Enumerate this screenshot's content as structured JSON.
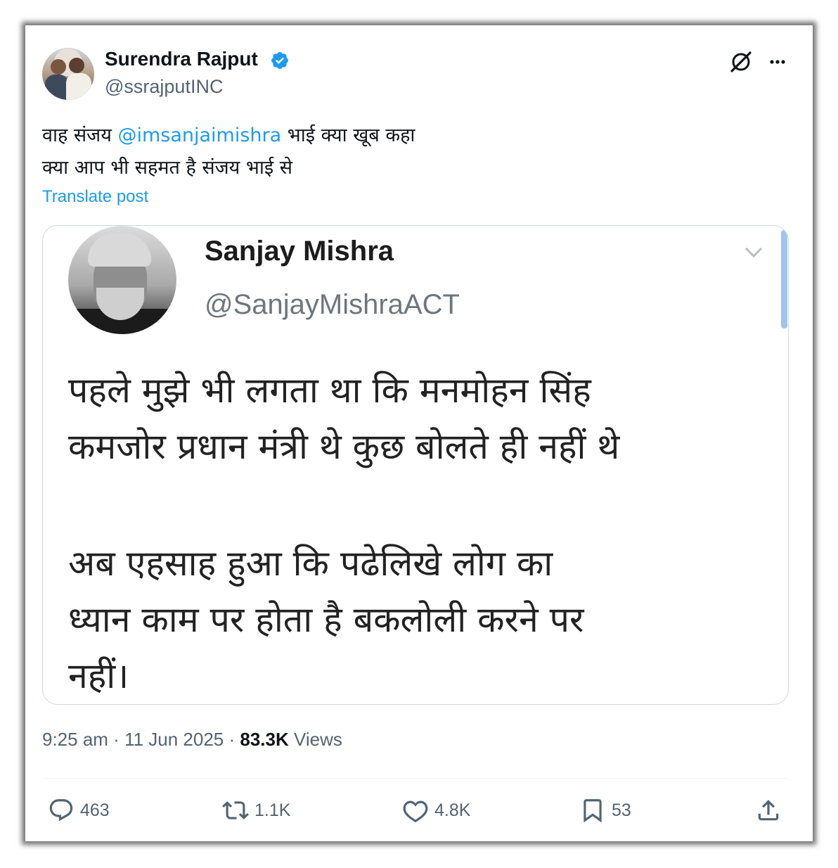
{
  "author": {
    "name": "Surendra Rajput",
    "handle": "@ssrajputINC"
  },
  "tweet": {
    "line1_prefix": "वाह संजय ",
    "mention": "@imsanjaimishra",
    "line1_suffix": " भाई क्या खूब कहा",
    "line2": "क्या आप भी सहमत है संजय भाई से",
    "translate_label": "Translate post"
  },
  "quoted_image": {
    "name": "Sanjay Mishra",
    "handle": "@SanjayMishraACT",
    "para1_line1": "पहले मुझे भी लगता था कि मनमोहन सिंह",
    "para1_line2": "कमजोर प्रधान मंत्री थे कुछ बोलते ही नहीं थे",
    "para2_line1": "अब एहसाह हुआ कि पढेलिखे लोग का",
    "para2_line2": "ध्यान काम पर होता है बकलोली करने पर",
    "para2_line3": "नहीं।"
  },
  "meta": {
    "time": "9:25 am",
    "sep1": " · ",
    "date": "11 Jun 2025",
    "sep2": " · ",
    "views_count": "83.3K",
    "views_label": " Views"
  },
  "actions": {
    "replies": "463",
    "reposts": "1.1K",
    "likes": "4.8K",
    "bookmarks": "53"
  },
  "icons": {
    "verified": "verified-badge-icon",
    "grok": "grok-icon",
    "more": "more-icon",
    "reply": "reply-icon",
    "retweet": "retweet-icon",
    "like": "heart-icon",
    "bookmark": "bookmark-icon",
    "share": "share-icon"
  },
  "colors": {
    "accent": "#1d9bf0",
    "text": "#0f1419",
    "secondary": "#536471"
  }
}
